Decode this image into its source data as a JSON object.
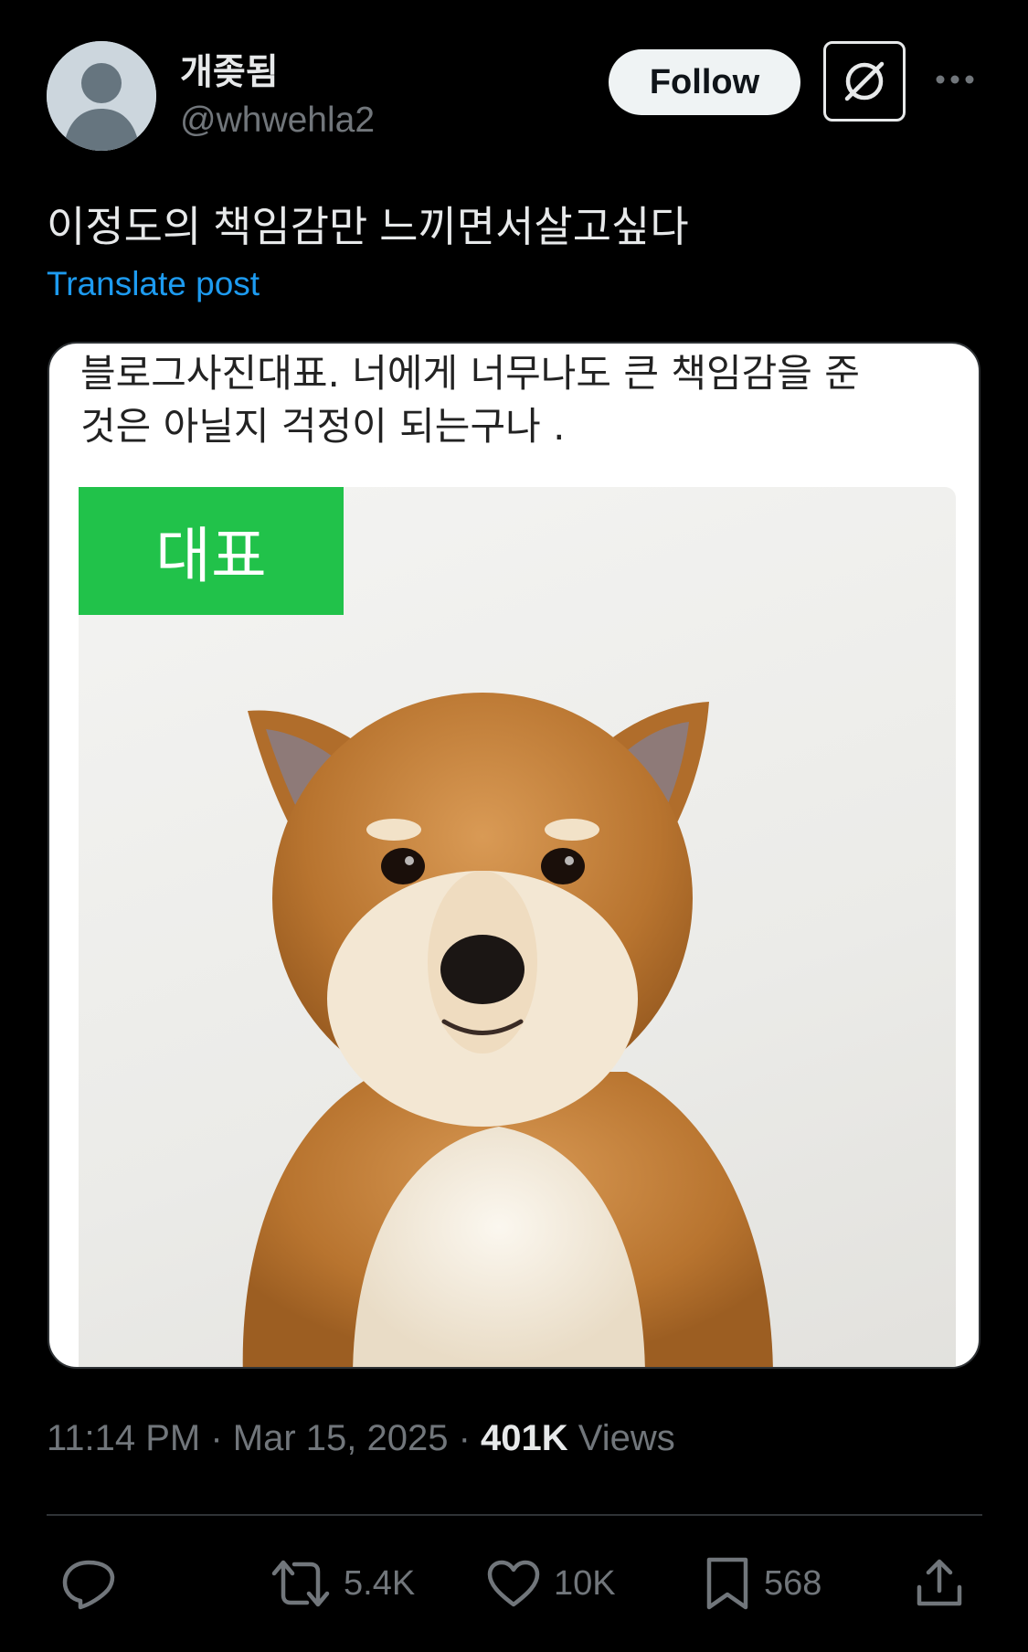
{
  "author": {
    "display_name": "개좆됨",
    "handle": "@whwehla2"
  },
  "header": {
    "follow_label": "Follow",
    "grok_icon": "grok-icon",
    "more_icon": "more-icon"
  },
  "post": {
    "text": "이정도의 책임감만 느끼면서살고싶다",
    "translate_label": "Translate post"
  },
  "media": {
    "caption_line1": "블로그사진대표.      너에게 너무나도 큰 책임감을 준",
    "caption_line2": "것은 아닐지 걱정이 되는구나  .",
    "badge_label": "대표"
  },
  "meta": {
    "time": "11:14 PM",
    "separator": " · ",
    "date": "Mar 15, 2025",
    "views_count": "401K",
    "views_label": "Views"
  },
  "actions": {
    "replies": "",
    "reposts": "5.4K",
    "likes": "10K",
    "bookmarks": "568"
  },
  "colors": {
    "background": "#000000",
    "accent_link": "#1d9bf0",
    "badge_green": "#21c24a",
    "muted_text": "#71767b"
  }
}
